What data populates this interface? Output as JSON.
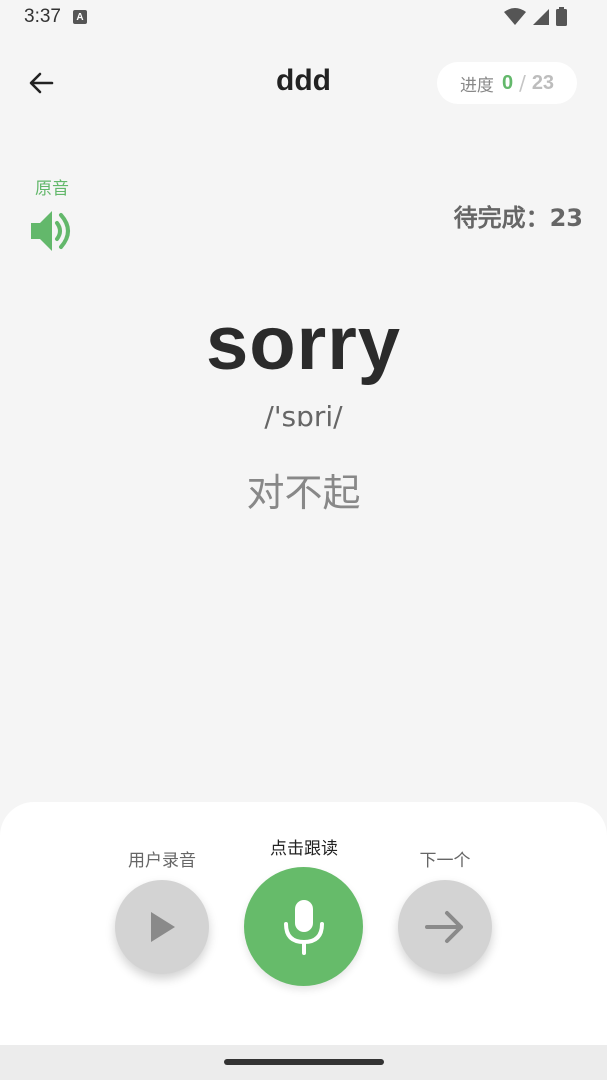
{
  "status_bar": {
    "time": "3:37",
    "a_badge": "A"
  },
  "header": {
    "title": "ddd",
    "progress_label": "进度",
    "progress_done": "0",
    "progress_separator": "/",
    "progress_total": "23"
  },
  "audio": {
    "original_label": "原音"
  },
  "pending": {
    "text": "待完成：23"
  },
  "card": {
    "word": "sorry",
    "phonetic": "/'sɒri/",
    "meaning": "对不起"
  },
  "controls": {
    "record_label": "用户录音",
    "read_label": "点击跟读",
    "next_label": "下一个"
  },
  "colors": {
    "accent": "#66bb6a",
    "background": "#f5f5f5",
    "disabled_button": "#d3d3d3"
  },
  "icons": {
    "back": "arrow-left-icon",
    "speaker": "speaker-icon",
    "play": "play-icon",
    "mic": "microphone-icon",
    "next": "arrow-right-icon"
  }
}
